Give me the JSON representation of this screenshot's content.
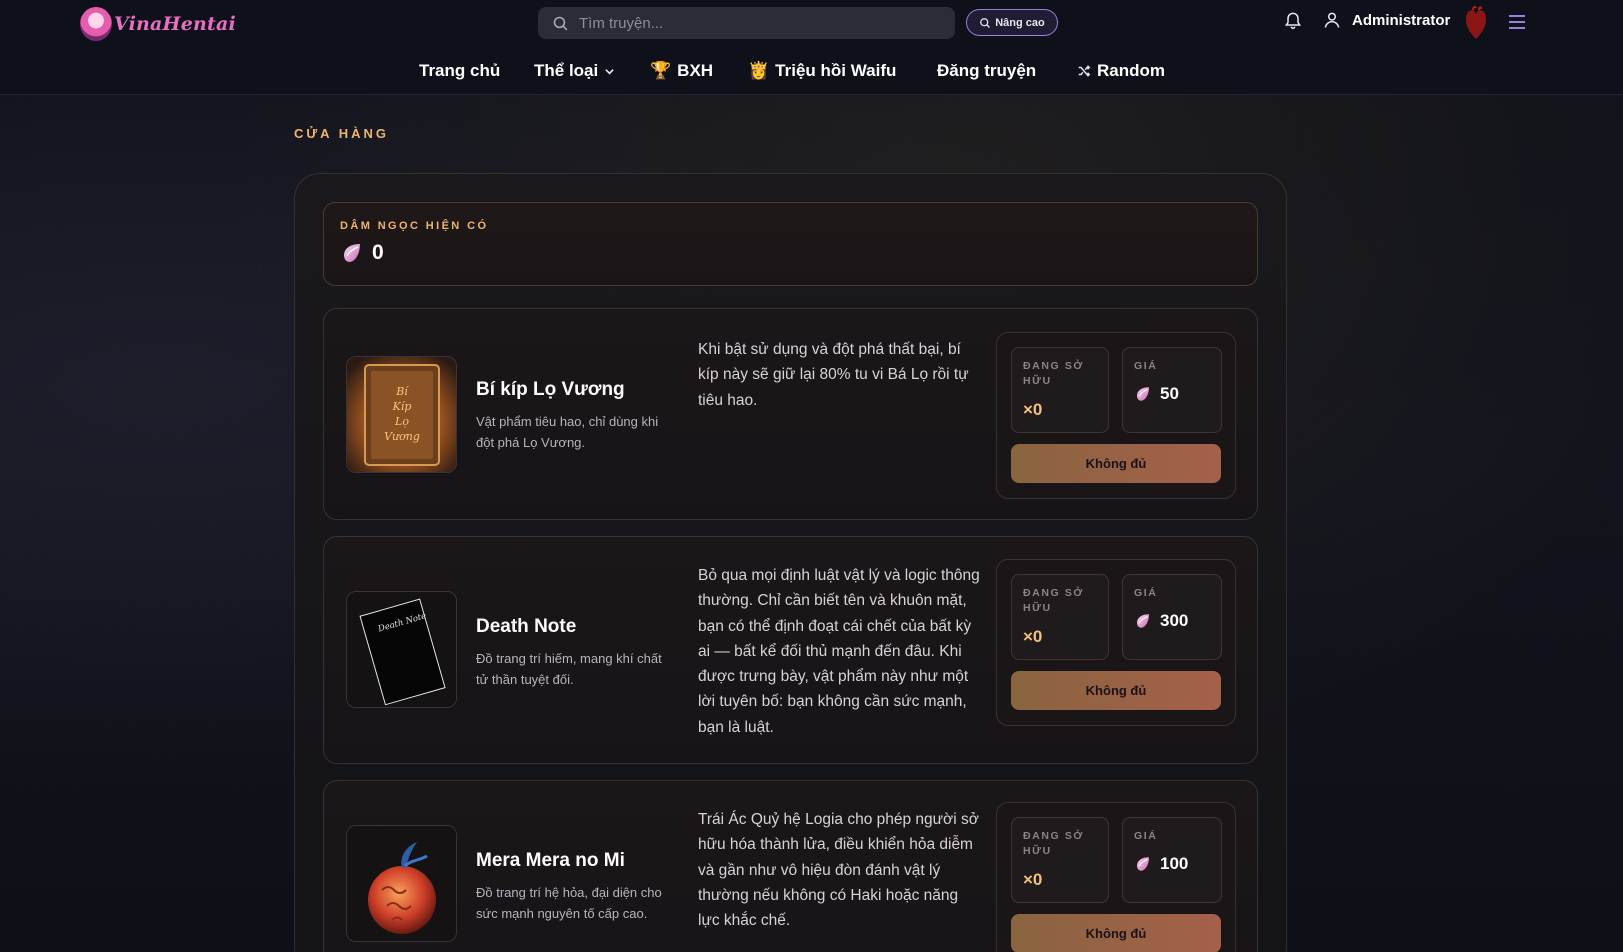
{
  "brand": {
    "name": "VinaHentai"
  },
  "search": {
    "placeholder": "Tìm truyện..."
  },
  "header": {
    "advanced_label": "Nâng cao",
    "username": "Administrator"
  },
  "nav": {
    "items": [
      {
        "label": "Trang chủ"
      },
      {
        "label": "Thể loại"
      },
      {
        "label": "BXH",
        "emoji": "🏆"
      },
      {
        "label": "Triệu hồi Waifu",
        "emoji": "👸"
      },
      {
        "label": "Đăng truyện"
      },
      {
        "label": "Random"
      }
    ]
  },
  "shop": {
    "title": "CỬA HÀNG",
    "balance_label": "DÂM NGỌC HIỆN CÓ",
    "balance_value": "0",
    "items": [
      {
        "name": "Bí kíp Lọ Vương",
        "subtitle": "Vật phẩm tiêu hao, chỉ dùng khi đột phá Lọ Vương.",
        "description": "Khi bật sử dụng và đột phá thất bại, bí kíp này sẽ giữ lại 80% tu vi Bá Lọ rồi tự tiêu hao.",
        "owned_label": "ĐANG SỞ HỮU",
        "owned_value": "×0",
        "price_label": "GIÁ",
        "price_value": "50",
        "button_label": "Không đủ",
        "image_icon": "book-icon",
        "book_text": "Bí Kíp Lọ Vương"
      },
      {
        "name": "Death Note",
        "subtitle": "Đồ trang trí hiếm, mang khí chất tử thần tuyệt đối.",
        "description": "Bỏ qua mọi định luật vật lý và logic thông thường. Chỉ cần biết tên và khuôn mặt, bạn có thể định đoạt cái chết của bất kỳ ai — bất kể đối thủ mạnh đến đâu. Khi được trưng bày, vật phẩm này như một lời tuyên bố: bạn không cần sức mạnh, bạn là luật.",
        "owned_label": "ĐANG SỞ HỮU",
        "owned_value": "×0",
        "price_label": "GIÁ",
        "price_value": "300",
        "button_label": "Không đủ",
        "image_icon": "death-note-icon",
        "book_text": "Death Note"
      },
      {
        "name": "Mera Mera no Mi",
        "subtitle": "Đồ trang trí hệ hỏa, đại diện cho sức mạnh nguyên tố cấp cao.",
        "description": "Trái Ác Quỷ hệ Logia cho phép người sở hữu hóa thành lửa, điều khiển hỏa diễm và gần như vô hiệu đòn đánh vật lý thường nếu không có Haki hoặc năng lực khắc chế.",
        "owned_label": "ĐANG SỞ HỮU",
        "owned_value": "×0",
        "price_label": "GIÁ",
        "price_value": "100",
        "button_label": "Không đủ",
        "image_icon": "devil-fruit-icon"
      }
    ]
  },
  "colors": {
    "accent": "#f2b36a",
    "nav_accent": "#9a7fe0",
    "button": "#a5604a",
    "owned": "#f2c07a"
  }
}
